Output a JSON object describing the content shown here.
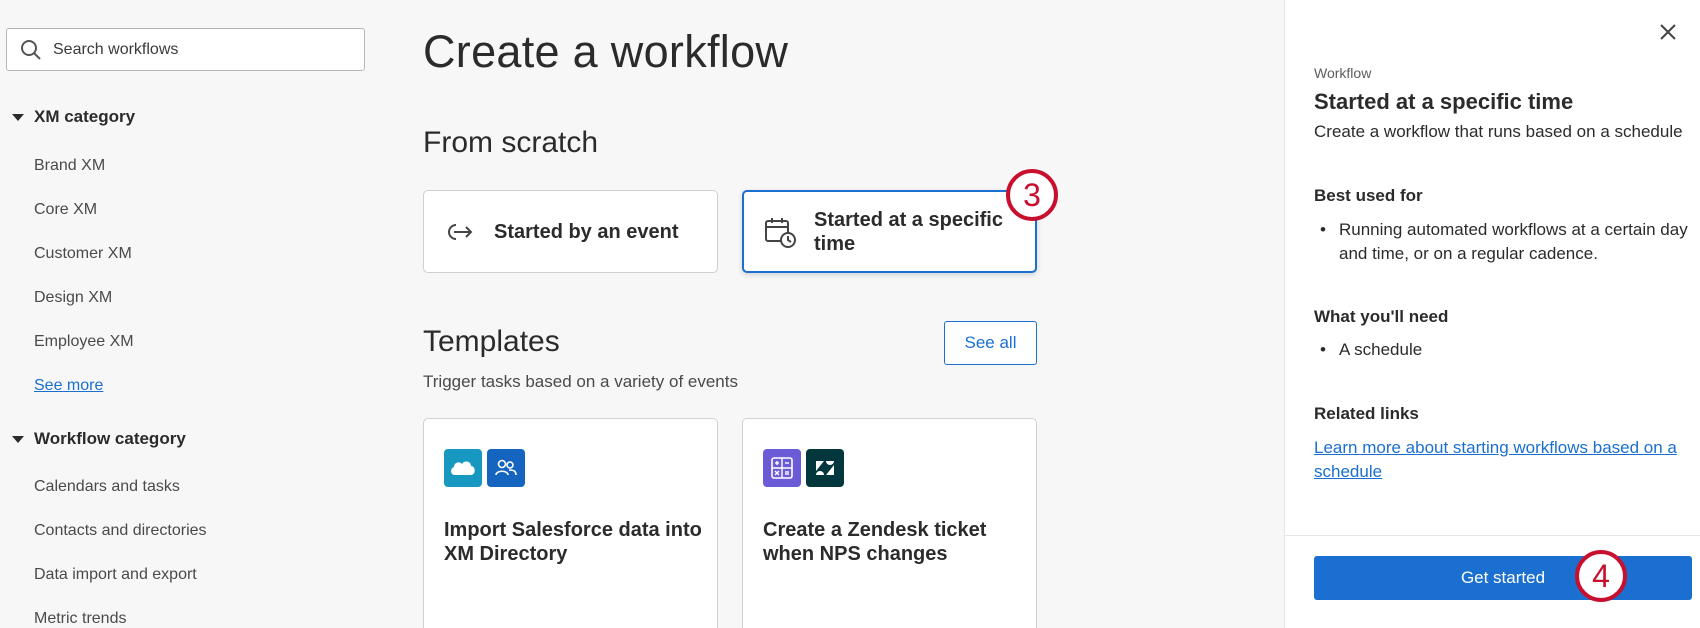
{
  "search": {
    "placeholder": "Search workflows"
  },
  "sidebar": {
    "xm_category": {
      "label": "XM category",
      "items": [
        "Brand XM",
        "Core XM",
        "Customer XM",
        "Design XM",
        "Employee XM"
      ],
      "see_more": "See more"
    },
    "workflow_category": {
      "label": "Workflow category",
      "items": [
        "Calendars and tasks",
        "Contacts and directories",
        "Data import and export",
        "Metric trends"
      ]
    }
  },
  "main": {
    "title": "Create a workflow",
    "from_scratch": {
      "heading": "From scratch",
      "cards": [
        {
          "label": "Started by an event",
          "icon": "event-arrow-icon",
          "selected": false
        },
        {
          "label": "Started at a specific time",
          "icon": "calendar-clock-icon",
          "selected": true
        }
      ]
    },
    "templates": {
      "heading": "Templates",
      "see_all": "See all",
      "subtitle": "Trigger tasks based on a variety of events",
      "cards": [
        {
          "title": "Import Salesforce data into XM Directory",
          "logos": [
            "salesforce-logo",
            "xm-directory-icon"
          ]
        },
        {
          "title": "Create a Zendesk ticket when NPS changes",
          "logos": [
            "calculator-icon",
            "zendesk-logo"
          ]
        }
      ]
    }
  },
  "annotations": {
    "step3": "3",
    "step4": "4"
  },
  "panel": {
    "eyebrow": "Workflow",
    "title": "Started at a specific time",
    "description": "Create a workflow that runs based on a schedule",
    "best_used_for": {
      "heading": "Best used for",
      "items": [
        "Running automated workflows at a certain day and time, or on a regular cadence."
      ]
    },
    "what_you_need": {
      "heading": "What you'll need",
      "items": [
        "A schedule"
      ]
    },
    "related_links": {
      "heading": "Related links",
      "link": "Learn more about starting workflows based on a schedule"
    },
    "cta": "Get started"
  },
  "colors": {
    "accent": "#1a6fd0",
    "annotation": "#c8102e",
    "salesforce": "#1798c1",
    "xm_directory": "#1565c0",
    "calculator": "#6b5bd6",
    "zendesk": "#03363d"
  }
}
